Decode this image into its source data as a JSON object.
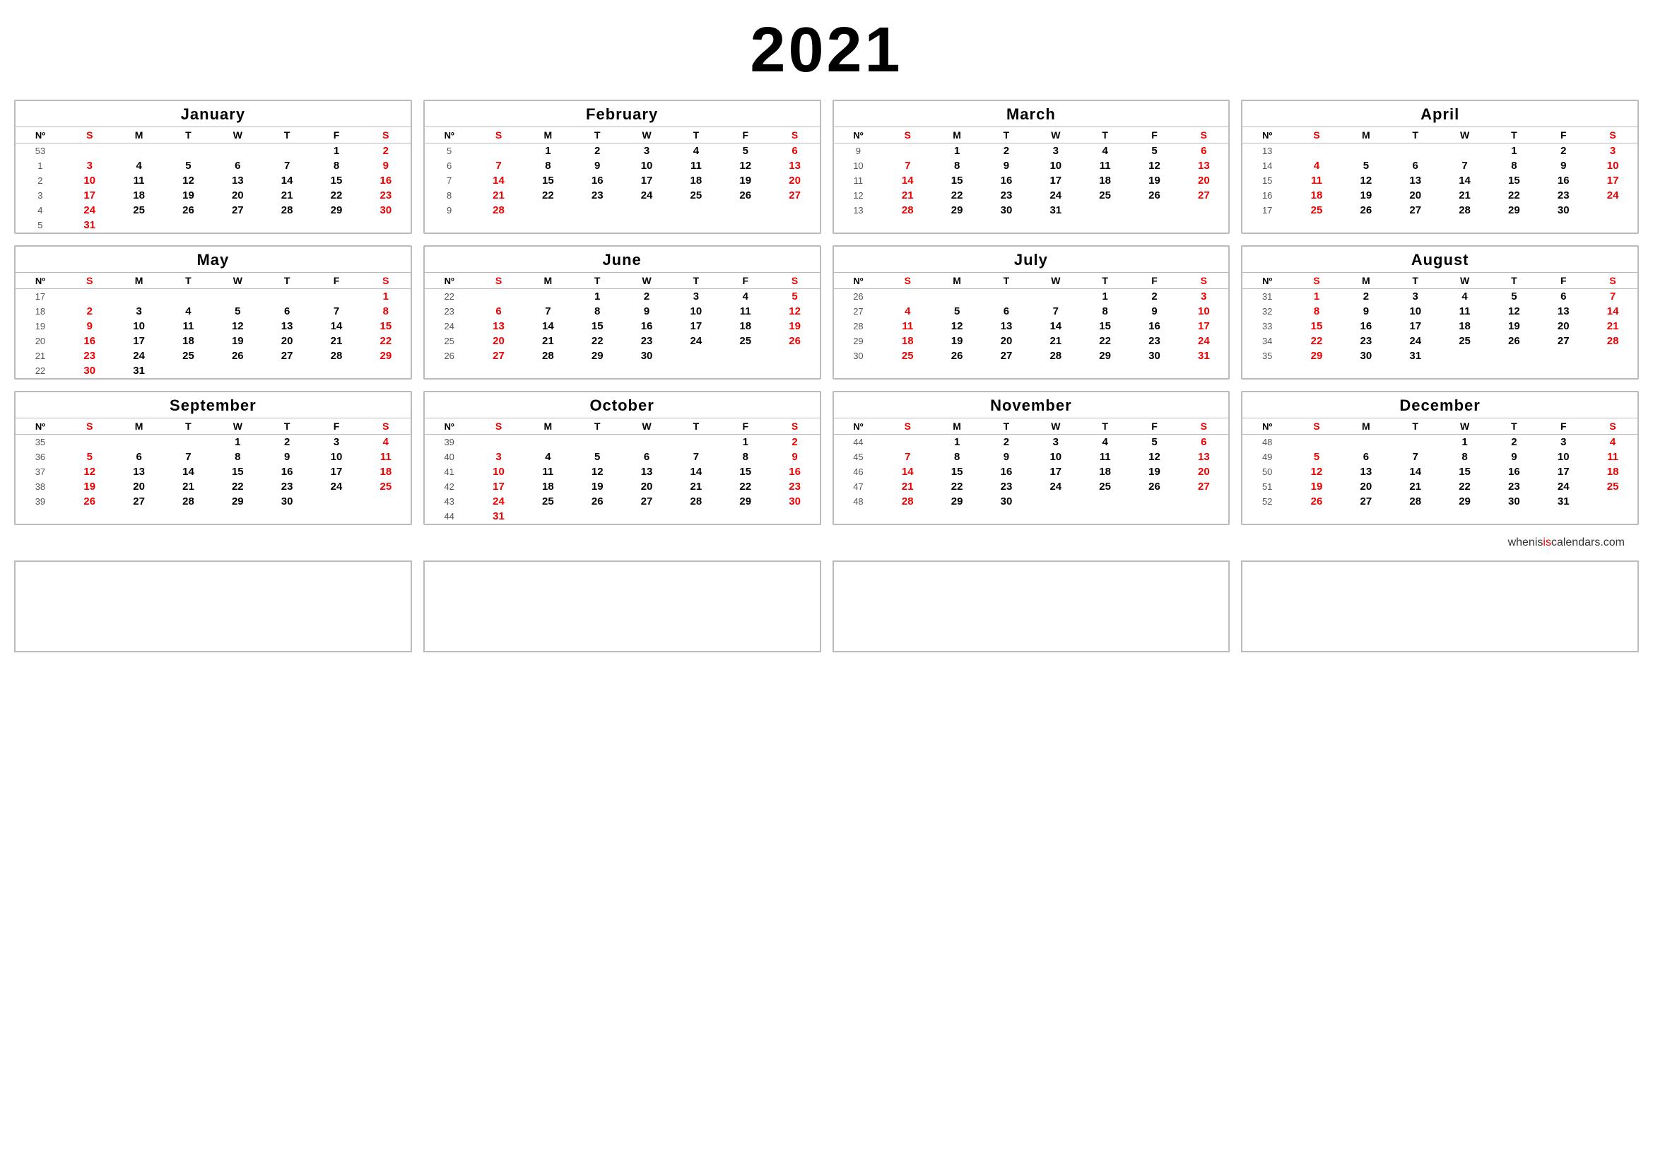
{
  "year": "2021",
  "footer": {
    "text1": "wheniscalendars.com",
    "red_part": "is",
    "prefix": "whenis"
  },
  "months": [
    {
      "name": "January",
      "weeks": [
        {
          "num": "53",
          "days": [
            "",
            "",
            "",
            "",
            "",
            "1",
            "2"
          ]
        },
        {
          "num": "1",
          "days": [
            "3",
            "4",
            "5",
            "6",
            "7",
            "8",
            "9"
          ]
        },
        {
          "num": "2",
          "days": [
            "10",
            "11",
            "12",
            "13",
            "14",
            "15",
            "16"
          ]
        },
        {
          "num": "3",
          "days": [
            "17",
            "18",
            "19",
            "20",
            "21",
            "22",
            "23"
          ]
        },
        {
          "num": "4",
          "days": [
            "24",
            "25",
            "26",
            "27",
            "28",
            "29",
            "30"
          ]
        },
        {
          "num": "5",
          "days": [
            "31",
            "",
            "",
            "",
            "",
            "",
            ""
          ]
        }
      ]
    },
    {
      "name": "February",
      "weeks": [
        {
          "num": "5",
          "days": [
            "",
            "1",
            "2",
            "3",
            "4",
            "5",
            "6"
          ]
        },
        {
          "num": "6",
          "days": [
            "7",
            "8",
            "9",
            "10",
            "11",
            "12",
            "13"
          ]
        },
        {
          "num": "7",
          "days": [
            "14",
            "15",
            "16",
            "17",
            "18",
            "19",
            "20"
          ]
        },
        {
          "num": "8",
          "days": [
            "21",
            "22",
            "23",
            "24",
            "25",
            "26",
            "27"
          ]
        },
        {
          "num": "9",
          "days": [
            "28",
            "",
            "",
            "",
            "",
            "",
            ""
          ]
        }
      ]
    },
    {
      "name": "March",
      "weeks": [
        {
          "num": "9",
          "days": [
            "",
            "1",
            "2",
            "3",
            "4",
            "5",
            "6"
          ]
        },
        {
          "num": "10",
          "days": [
            "7",
            "8",
            "9",
            "10",
            "11",
            "12",
            "13"
          ]
        },
        {
          "num": "11",
          "days": [
            "14",
            "15",
            "16",
            "17",
            "18",
            "19",
            "20"
          ]
        },
        {
          "num": "12",
          "days": [
            "21",
            "22",
            "23",
            "24",
            "25",
            "26",
            "27"
          ]
        },
        {
          "num": "13",
          "days": [
            "28",
            "29",
            "30",
            "31",
            "",
            "",
            ""
          ]
        }
      ]
    },
    {
      "name": "April",
      "weeks": [
        {
          "num": "13",
          "days": [
            "",
            "",
            "",
            "",
            "1",
            "2",
            "3"
          ]
        },
        {
          "num": "14",
          "days": [
            "4",
            "5",
            "6",
            "7",
            "8",
            "9",
            "10"
          ]
        },
        {
          "num": "15",
          "days": [
            "11",
            "12",
            "13",
            "14",
            "15",
            "16",
            "17"
          ]
        },
        {
          "num": "16",
          "days": [
            "18",
            "19",
            "20",
            "21",
            "22",
            "23",
            "24"
          ]
        },
        {
          "num": "17",
          "days": [
            "25",
            "26",
            "27",
            "28",
            "29",
            "30",
            ""
          ]
        }
      ]
    },
    {
      "name": "May",
      "weeks": [
        {
          "num": "17",
          "days": [
            "",
            "",
            "",
            "",
            "",
            "",
            "1"
          ]
        },
        {
          "num": "18",
          "days": [
            "2",
            "3",
            "4",
            "5",
            "6",
            "7",
            "8"
          ]
        },
        {
          "num": "19",
          "days": [
            "9",
            "10",
            "11",
            "12",
            "13",
            "14",
            "15"
          ]
        },
        {
          "num": "20",
          "days": [
            "16",
            "17",
            "18",
            "19",
            "20",
            "21",
            "22"
          ]
        },
        {
          "num": "21",
          "days": [
            "23",
            "24",
            "25",
            "26",
            "27",
            "28",
            "29"
          ]
        },
        {
          "num": "22",
          "days": [
            "30",
            "31",
            "",
            "",
            "",
            "",
            ""
          ]
        }
      ]
    },
    {
      "name": "June",
      "weeks": [
        {
          "num": "22",
          "days": [
            "",
            "",
            "1",
            "2",
            "3",
            "4",
            "5"
          ]
        },
        {
          "num": "23",
          "days": [
            "6",
            "7",
            "8",
            "9",
            "10",
            "11",
            "12"
          ]
        },
        {
          "num": "24",
          "days": [
            "13",
            "14",
            "15",
            "16",
            "17",
            "18",
            "19"
          ]
        },
        {
          "num": "25",
          "days": [
            "20",
            "21",
            "22",
            "23",
            "24",
            "25",
            "26"
          ]
        },
        {
          "num": "26",
          "days": [
            "27",
            "28",
            "29",
            "30",
            "",
            "",
            ""
          ]
        }
      ]
    },
    {
      "name": "July",
      "weeks": [
        {
          "num": "26",
          "days": [
            "",
            "",
            "",
            "",
            "1",
            "2",
            "3"
          ]
        },
        {
          "num": "27",
          "days": [
            "4",
            "5",
            "6",
            "7",
            "8",
            "9",
            "10"
          ]
        },
        {
          "num": "28",
          "days": [
            "11",
            "12",
            "13",
            "14",
            "15",
            "16",
            "17"
          ]
        },
        {
          "num": "29",
          "days": [
            "18",
            "19",
            "20",
            "21",
            "22",
            "23",
            "24"
          ]
        },
        {
          "num": "30",
          "days": [
            "25",
            "26",
            "27",
            "28",
            "29",
            "30",
            "31"
          ]
        }
      ]
    },
    {
      "name": "August",
      "weeks": [
        {
          "num": "31",
          "days": [
            "1",
            "2",
            "3",
            "4",
            "5",
            "6",
            "7"
          ]
        },
        {
          "num": "32",
          "days": [
            "8",
            "9",
            "10",
            "11",
            "12",
            "13",
            "14"
          ]
        },
        {
          "num": "33",
          "days": [
            "15",
            "16",
            "17",
            "18",
            "19",
            "20",
            "21"
          ]
        },
        {
          "num": "34",
          "days": [
            "22",
            "23",
            "24",
            "25",
            "26",
            "27",
            "28"
          ]
        },
        {
          "num": "35",
          "days": [
            "29",
            "30",
            "31",
            "",
            "",
            "",
            ""
          ]
        }
      ]
    },
    {
      "name": "September",
      "weeks": [
        {
          "num": "35",
          "days": [
            "",
            "",
            "",
            "1",
            "2",
            "3",
            "4"
          ]
        },
        {
          "num": "36",
          "days": [
            "5",
            "6",
            "7",
            "8",
            "9",
            "10",
            "11"
          ]
        },
        {
          "num": "37",
          "days": [
            "12",
            "13",
            "14",
            "15",
            "16",
            "17",
            "18"
          ]
        },
        {
          "num": "38",
          "days": [
            "19",
            "20",
            "21",
            "22",
            "23",
            "24",
            "25"
          ]
        },
        {
          "num": "39",
          "days": [
            "26",
            "27",
            "28",
            "29",
            "30",
            "",
            ""
          ]
        }
      ]
    },
    {
      "name": "October",
      "weeks": [
        {
          "num": "39",
          "days": [
            "",
            "",
            "",
            "",
            "",
            "1",
            "2"
          ]
        },
        {
          "num": "40",
          "days": [
            "3",
            "4",
            "5",
            "6",
            "7",
            "8",
            "9"
          ]
        },
        {
          "num": "41",
          "days": [
            "10",
            "11",
            "12",
            "13",
            "14",
            "15",
            "16"
          ]
        },
        {
          "num": "42",
          "days": [
            "17",
            "18",
            "19",
            "20",
            "21",
            "22",
            "23"
          ]
        },
        {
          "num": "43",
          "days": [
            "24",
            "25",
            "26",
            "27",
            "28",
            "29",
            "30"
          ]
        },
        {
          "num": "44",
          "days": [
            "31",
            "",
            "",
            "",
            "",
            "",
            ""
          ]
        }
      ]
    },
    {
      "name": "November",
      "weeks": [
        {
          "num": "44",
          "days": [
            "",
            "1",
            "2",
            "3",
            "4",
            "5",
            "6"
          ]
        },
        {
          "num": "45",
          "days": [
            "7",
            "8",
            "9",
            "10",
            "11",
            "12",
            "13"
          ]
        },
        {
          "num": "46",
          "days": [
            "14",
            "15",
            "16",
            "17",
            "18",
            "19",
            "20"
          ]
        },
        {
          "num": "47",
          "days": [
            "21",
            "22",
            "23",
            "24",
            "25",
            "26",
            "27"
          ]
        },
        {
          "num": "48",
          "days": [
            "28",
            "29",
            "30",
            "",
            "",
            "",
            ""
          ]
        }
      ]
    },
    {
      "name": "December",
      "weeks": [
        {
          "num": "48",
          "days": [
            "",
            "",
            "",
            "1",
            "2",
            "3",
            "4"
          ]
        },
        {
          "num": "49",
          "days": [
            "5",
            "6",
            "7",
            "8",
            "9",
            "10",
            "11"
          ]
        },
        {
          "num": "50",
          "days": [
            "12",
            "13",
            "14",
            "15",
            "16",
            "17",
            "18"
          ]
        },
        {
          "num": "51",
          "days": [
            "19",
            "20",
            "21",
            "22",
            "23",
            "24",
            "25"
          ]
        },
        {
          "num": "52",
          "days": [
            "26",
            "27",
            "28",
            "29",
            "30",
            "31",
            ""
          ]
        }
      ]
    }
  ]
}
